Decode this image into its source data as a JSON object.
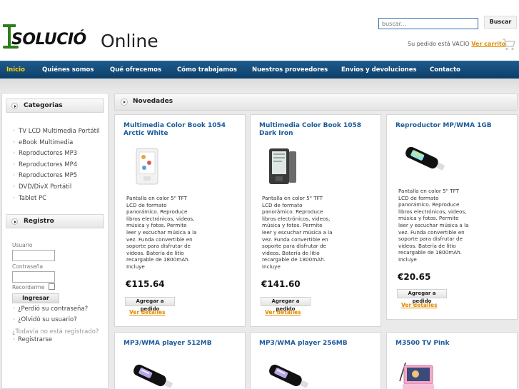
{
  "header": {
    "brand_main": "SOLUCIÓ",
    "brand_second": "Online",
    "search_placeholder": "buscar...",
    "search_button": "Buscar",
    "cart_status": "Su pedido está VACIO",
    "cart_link": "Ver carrito"
  },
  "nav": {
    "items": [
      "Inicio",
      "Quiénes somos",
      "Qué ofrecemos",
      "Cómo trabajamos",
      "Nuestros proveedores",
      "Envios y devoluciones",
      "Contacto"
    ],
    "active_index": 0
  },
  "sidebar": {
    "categories_title": "Categorias",
    "categories": [
      "TV LCD Multimedia Portátil",
      "eBook Multimedia",
      "Reproductores MP3",
      "Reproductores MP4",
      "Reproductores MP5",
      "DVD/DivX Portátil",
      "Tablet PC"
    ],
    "register_title": "Registro",
    "user_label": "Usuario",
    "password_label": "Contraseña",
    "remember_label": "Recordarme",
    "login_button": "Ingresar",
    "forgot_password": "¿Perdió su contraseña?",
    "forgot_user": "¿Olvidó su usuario?",
    "not_registered": "¿Todavía no está registrado?",
    "register_link": "Registrarse"
  },
  "main": {
    "section_title": "Novedades",
    "products": [
      {
        "title": "Multimedia Color Book 1054 Arctic White",
        "description": "Pantalla en color 5\" TFT LCD de formato panorámico. Reproduce libros electrónicos, videos, música y fotos. Permite leer y escuchar música a la vez. Funda convertible en soporte para disfrutar de videos. Batería de litio recargable de 1800mAh. Incluye",
        "price": "€115.64",
        "add_button": "Agregar a pedido",
        "details_link": "Ver detalles"
      },
      {
        "title": "Multimedia Color Book 1058 Dark Iron",
        "description": "Pantalla en color 5\" TFT LCD de formato panorámico. Reproduce libros electrónicos, videos, música y fotos. Permite leer y escuchar música a la vez. Funda convertible en soporte para disfrutar de videos. Batería de litio recargable de 1800mAh. Incluye",
        "price": "€141.60",
        "add_button": "Agregar a pedido",
        "details_link": "Ver detalles"
      },
      {
        "title": "Reproductor MP/WMA 1GB",
        "description": "Pantalla en color 5\" TFT LCD de formato panorámico. Reproduce libros electrónicos, videos, música y fotos. Permite leer y escuchar música a la vez. Funda convertible en soporte para disfrutar de videos. Batería de litio recargable de 1800mAh. Incluye",
        "price": "€20.65",
        "add_button": "Agregar a pedido",
        "details_link": "Ver detalles"
      },
      {
        "title": "MP3/WMA player 512MB"
      },
      {
        "title": "MP3/WMA player 256MB"
      },
      {
        "title": "M3500 TV Pink"
      }
    ]
  },
  "colors": {
    "nav_bg": "#0d3f69",
    "nav_active": "#ffd400",
    "title_link": "#1a5a9a",
    "accent_link": "#e08a00",
    "logo_green": "#2e7d1c"
  }
}
